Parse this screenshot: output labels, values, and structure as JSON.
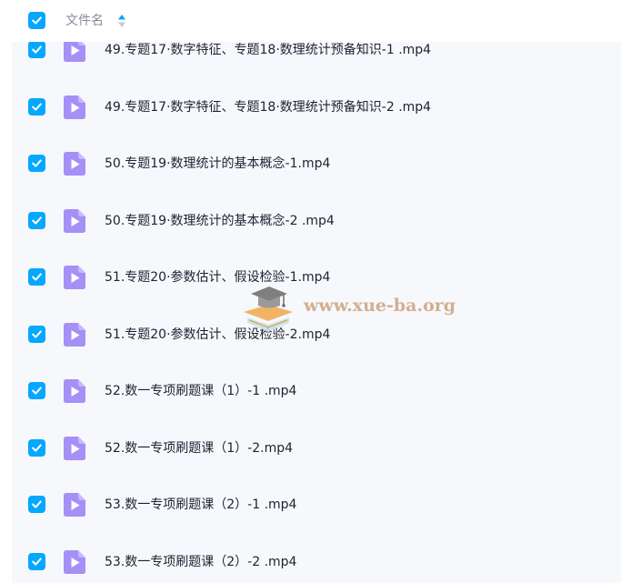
{
  "header": {
    "select_all_checked": true,
    "column_label": "文件名"
  },
  "files": [
    {
      "name": "49.专题17·数字特征、专题18·数理统计预备知识-1 .mp4",
      "checked": true
    },
    {
      "name": "49.专题17·数字特征、专题18·数理统计预备知识-2 .mp4",
      "checked": true
    },
    {
      "name": "50.专题19·数理统计的基本概念-1.mp4",
      "checked": true
    },
    {
      "name": "50.专题19·数理统计的基本概念-2 .mp4",
      "checked": true
    },
    {
      "name": "51.专题20·参数估计、假设检验-1.mp4",
      "checked": true
    },
    {
      "name": "51.专题20·参数估计、假设检验-2.mp4",
      "checked": true
    },
    {
      "name": "52.数一专项刷题课（1）-1 .mp4",
      "checked": true
    },
    {
      "name": "52.数一专项刷题课（1）-2.mp4",
      "checked": true
    },
    {
      "name": "53.数一专项刷题课（2）-1 .mp4",
      "checked": true
    },
    {
      "name": "53.数一专项刷题课（2）-2 .mp4",
      "checked": true
    }
  ],
  "watermark": {
    "text": "www.xue-ba.org"
  },
  "icons": {
    "checkbox": "checkbox-checked-icon",
    "sort": "sort-icon",
    "file": "video-file-icon"
  },
  "colors": {
    "accent": "#06a7ff",
    "video_icon": "#a590f6",
    "list_background": "#f7f8fc",
    "text": "#1e2230",
    "header_text": "#878c9c"
  }
}
